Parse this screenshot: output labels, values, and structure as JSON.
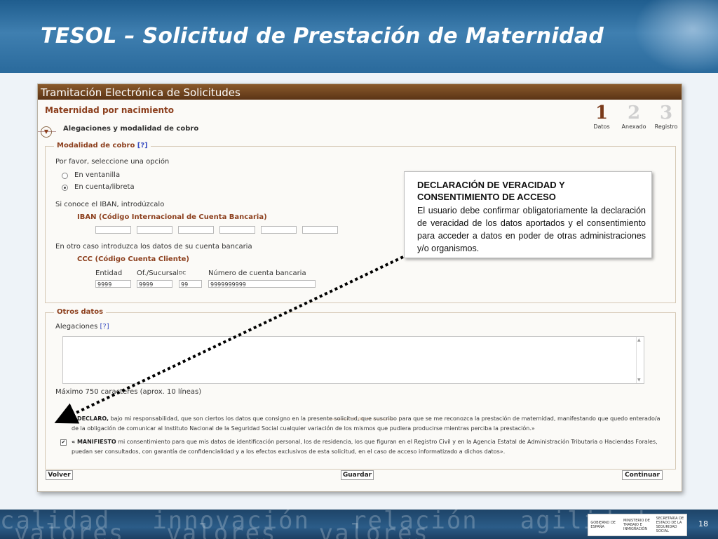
{
  "slide": {
    "title": "TESOL – Solicitud de Prestación de Maternidad",
    "page_number": "18",
    "footer_words": [
      "calidad",
      "innovación",
      "relación",
      "agilidad",
      "valores",
      "valores",
      "valores"
    ],
    "logos": {
      "logo1": "GOBIERNO DE ESPAÑA",
      "logo2": "MINISTERIO DE TRABAJO E INMIGRACIÓN",
      "logo3": "SECRETARÍA DE ESTADO DE LA SEGURIDAD SOCIAL"
    }
  },
  "app": {
    "bar_title": "Tramitación Electrónica de Solicitudes",
    "section_title": "Maternidad por nacimiento",
    "subsection": "Alegaciones y modalidad de cobro",
    "steps": [
      {
        "num": "1",
        "label": "Datos"
      },
      {
        "num": "2",
        "label": "Anexado"
      },
      {
        "num": "3",
        "label": "Registro"
      }
    ],
    "modalidad": {
      "legend": "Modalidad de cobro",
      "help": "[?]",
      "prompt": "Por favor, seleccione una opción",
      "options": [
        "En ventanilla",
        "En cuenta/libreta"
      ],
      "selected": "En cuenta/libreta",
      "iban_prompt": "Si conoce el IBAN, introdúzcalo",
      "iban_label": "IBAN (Código Internacional de Cuenta Bancaria)",
      "other_prompt": "En otro caso introduzca los datos de su cuenta bancaria",
      "ccc_label": "CCC (Código Cuenta Cliente)",
      "ccc_headers": {
        "entidad": "Entidad",
        "sucursal": "Of./Sucursal",
        "dc": "DC",
        "cuenta": "Número de cuenta bancaria"
      },
      "ccc_values": {
        "entidad": "9999",
        "sucursal": "9999",
        "dc": "99",
        "cuenta": "9999999999"
      }
    },
    "otros": {
      "legend": "Otros datos",
      "alegaciones_label": "Alegaciones",
      "help": "[?]",
      "max_text": "Máximo 750 caracteres (aprox. 10 líneas)",
      "declaro_bold": "« DECLARO,",
      "declaro_text": " bajo mi responsabilidad, que son ciertos los datos que consigno en la presente solicitud, que suscribo para que se me reconozca la prestación de maternidad, manifestando que quedo enterado/a de la obligación de comunicar al Instituto Nacional de la Seguridad Social cualquier variación de los mismos que pudiera producirse mientras perciba la prestación.»",
      "manifiesto_bold": "« MANIFIESTO",
      "manifiesto_text": " mi consentimiento para que mis datos de identificación personal, los de residencia, los que figuran en el Registro Civil y en la Agencia Estatal de Administración Tributaria o Haciendas Forales, puedan ser consultados, con garantía de confidencialidad y a los efectos exclusivos de esta solicitud, en el caso de acceso informatizado a dichos datos».",
      "check_mark": "✔"
    },
    "buttons": {
      "volver": "Volver",
      "guardar": "Guardar",
      "continuar": "Continuar"
    }
  },
  "callout": {
    "title": "DECLARACIÓN DE VERACIDAD Y CONSENTIMIENTO DE ACCESO",
    "body": "El usuario debe confirmar obligatoriamente la declaración de veracidad de los datos aportados y el consentimiento para acceder a datos en poder de otras administraciones y/o organismos."
  }
}
